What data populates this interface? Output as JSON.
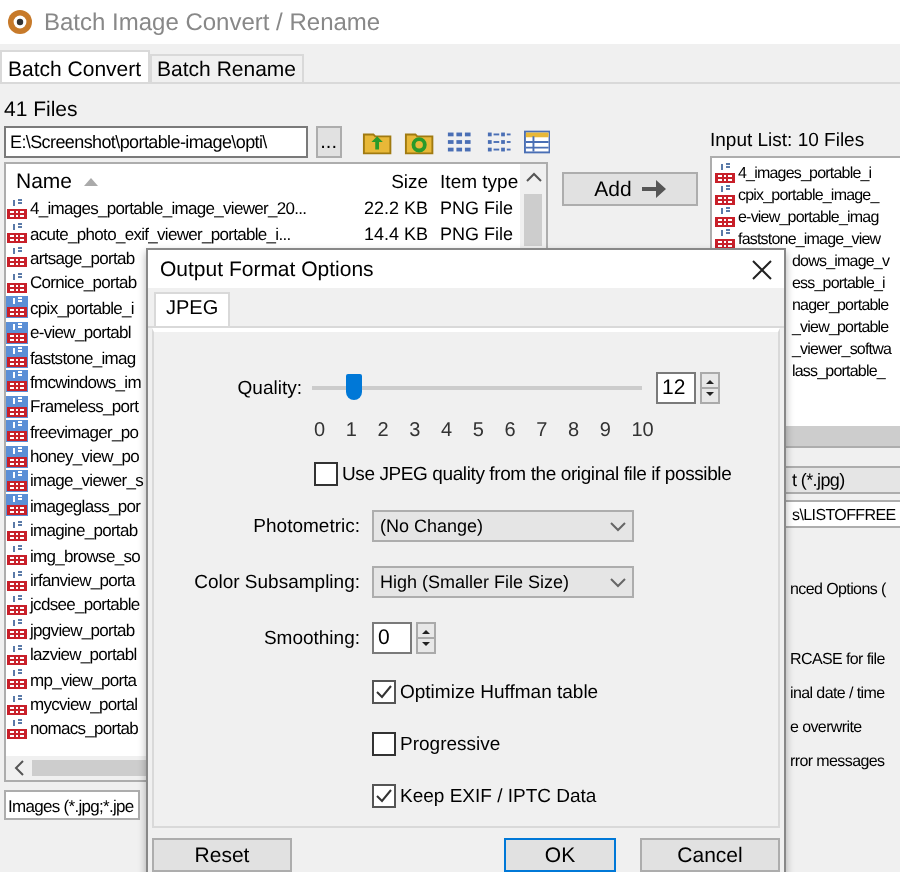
{
  "window": {
    "title": "Batch Image Convert / Rename"
  },
  "tabs": [
    {
      "label": "Batch Convert",
      "selected": true
    },
    {
      "label": "Batch Rename",
      "selected": false
    }
  ],
  "file_count": "41 Files",
  "path_field": {
    "value": "E:\\Screenshot\\portable-image\\opti\\"
  },
  "browse_button": "...",
  "file_list": {
    "columns": [
      "Name",
      "Size",
      "Item type"
    ],
    "rows": [
      {
        "name": "4_images_portable_image_viewer_20...",
        "size": "22.2 KB",
        "type": "PNG File",
        "selected": false
      },
      {
        "name": "acute_photo_exif_viewer_portable_i...",
        "size": "14.4 KB",
        "type": "PNG File",
        "selected": false
      },
      {
        "name": "artsage_portab",
        "selected": false
      },
      {
        "name": "Cornice_portab",
        "selected": false
      },
      {
        "name": "cpix_portable_i",
        "selected": true
      },
      {
        "name": "e-view_portabl",
        "selected": true
      },
      {
        "name": "faststone_imag",
        "selected": true
      },
      {
        "name": "fmcwindows_im",
        "selected": true
      },
      {
        "name": "Frameless_port",
        "selected": true
      },
      {
        "name": "freevimager_po",
        "selected": true
      },
      {
        "name": "honey_view_po",
        "selected": true
      },
      {
        "name": "image_viewer_s",
        "selected": true
      },
      {
        "name": "imageglass_por",
        "selected": true
      },
      {
        "name": "imagine_portab",
        "selected": false
      },
      {
        "name": "img_browse_so",
        "selected": false
      },
      {
        "name": "irfanview_porta",
        "selected": false
      },
      {
        "name": "jcdsee_portable",
        "selected": false
      },
      {
        "name": "jpgview_portab",
        "selected": false
      },
      {
        "name": "lazview_portabl",
        "selected": false
      },
      {
        "name": "mp_view_porta",
        "selected": false
      },
      {
        "name": "mycview_portal",
        "selected": false
      },
      {
        "name": "nomacs_portab",
        "selected": false
      }
    ]
  },
  "filter_field": {
    "value": "Images (*.jpg;*.jpe"
  },
  "add_button": "Add",
  "input_list": {
    "label": "Input List:  10 Files",
    "items": [
      {
        "name": "4_images_portable_i",
        "kind": "full"
      },
      {
        "name": "cpix_portable_image_",
        "kind": "full"
      },
      {
        "name": "e-view_portable_imag",
        "kind": "full"
      },
      {
        "name": "faststone_image_view",
        "kind": "full"
      },
      {
        "name": "dows_image_v",
        "kind": "clipped"
      },
      {
        "name": "ess_portable_i",
        "kind": "clipped"
      },
      {
        "name": "nager_portable",
        "kind": "clipped"
      },
      {
        "name": "_view_portable",
        "kind": "clipped"
      },
      {
        "name": "_viewer_softwa",
        "kind": "clipped"
      },
      {
        "name": "lass_portable_",
        "kind": "clipped"
      }
    ]
  },
  "output_format_field": {
    "value": "t (*.jpg)"
  },
  "output_path_field": {
    "value": "s\\LISTOFFREE"
  },
  "options": [
    "nced Options (",
    "RCASE for file",
    "inal date / time",
    "e overwrite",
    "rror messages"
  ],
  "dialog": {
    "title": "Output Format Options",
    "tabs": [
      {
        "label": "JPEG",
        "selected": true
      }
    ],
    "quality": {
      "label": "Quality:",
      "level": 0.12,
      "value": "12",
      "ticks": [
        "0",
        "1",
        "2",
        "3",
        "4",
        "5",
        "6",
        "7",
        "8",
        "9",
        "10"
      ]
    },
    "use_original": {
      "label": "Use JPEG quality from the original file if possible",
      "checked": false
    },
    "photometric": {
      "label": "Photometric:",
      "value": "(No Change)"
    },
    "subsampling": {
      "label": "Color Subsampling:",
      "value": "High (Smaller File Size)"
    },
    "smoothing": {
      "label": "Smoothing:",
      "value": "0"
    },
    "checkboxes": [
      {
        "label": "Optimize Huffman table",
        "checked": true
      },
      {
        "label": "Progressive",
        "checked": false
      },
      {
        "label": "Keep EXIF / IPTC Data",
        "checked": true
      }
    ],
    "buttons": {
      "reset": "Reset",
      "ok": "OK",
      "cancel": "Cancel"
    }
  }
}
